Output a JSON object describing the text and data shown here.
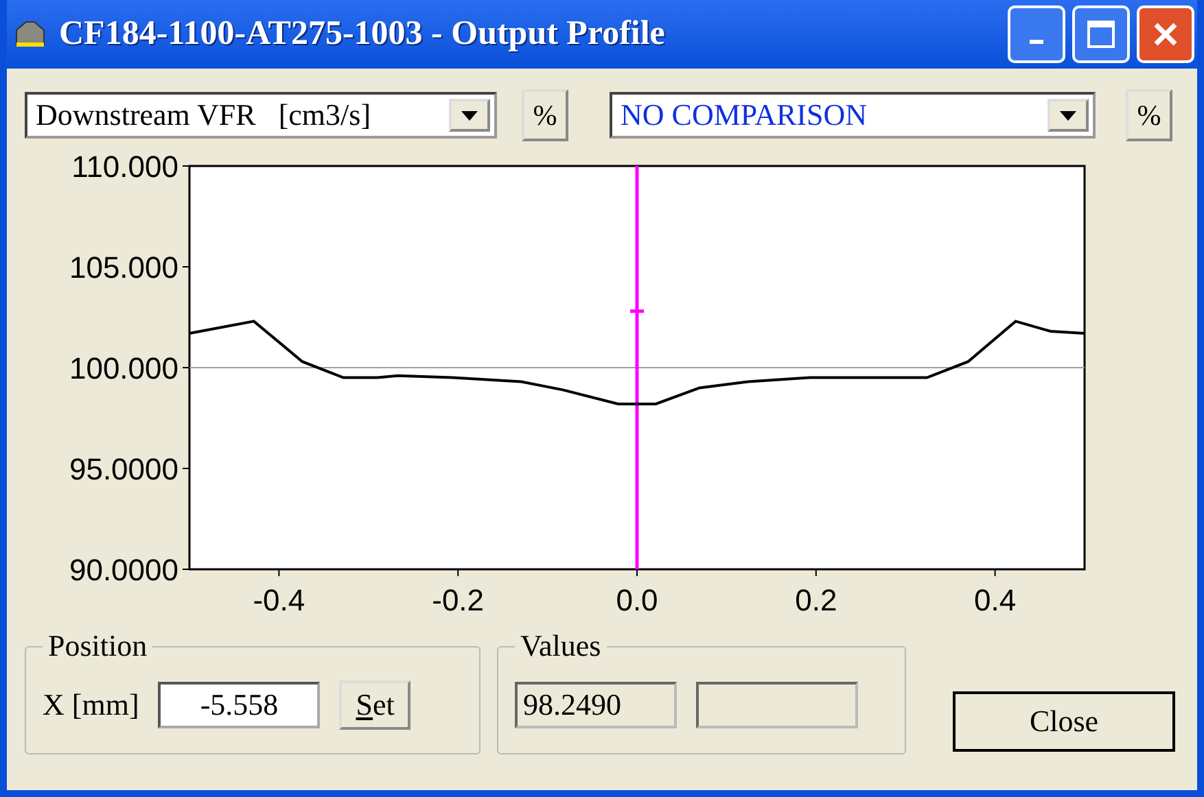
{
  "window": {
    "title": "CF184-1100-AT275-1003 - Output Profile"
  },
  "toolbar": {
    "quantity_select": {
      "value": "Downstream VFR   [cm3/s]"
    },
    "quantity_percent_button": "%",
    "comparison_select": {
      "value": "NO COMPARISON"
    },
    "comparison_percent_button": "%"
  },
  "chart": {
    "chart_data": {
      "type": "line",
      "xlim": [
        -0.5,
        0.5
      ],
      "ylim": [
        90,
        110
      ],
      "xticks": [
        {
          "value": -0.4,
          "label": "-0.4"
        },
        {
          "value": -0.2,
          "label": "-0.2"
        },
        {
          "value": 0,
          "label": "0.0"
        },
        {
          "value": 0.2,
          "label": "0.2"
        },
        {
          "value": 0.4,
          "label": "0.4"
        }
      ],
      "yticks": [
        {
          "value": 90,
          "label": "90.0000"
        },
        {
          "value": 95,
          "label": "95.0000"
        },
        {
          "value": 100,
          "label": "100.000"
        },
        {
          "value": 105,
          "label": "105.000"
        },
        {
          "value": 110,
          "label": "110.000"
        }
      ],
      "x": [
        -0.5,
        -0.428,
        -0.374,
        -0.328,
        -0.29,
        -0.267,
        -0.206,
        -0.129,
        -0.083,
        -0.021,
        0.021,
        0.07,
        0.124,
        0.193,
        0.27,
        0.324,
        0.37,
        0.423,
        0.462,
        0.5
      ],
      "series": [
        {
          "color": "#000000",
          "values": [
            101.7,
            102.3,
            100.3,
            99.5,
            99.5,
            99.6,
            99.5,
            99.3,
            98.9,
            98.2,
            98.2,
            99.0,
            99.3,
            99.5,
            99.5,
            99.5,
            100.3,
            102.3,
            101.8,
            101.7
          ]
        }
      ],
      "ref_lines": [
        {
          "axis": "y",
          "value": 100
        },
        {
          "axis": "x",
          "value": 0
        }
      ]
    }
  },
  "position": {
    "legend": "Position",
    "label": "X [mm]",
    "value": "-5.558",
    "set_button": "Set"
  },
  "values": {
    "legend": "Values",
    "reading": "98.2490"
  },
  "close_button": "Close"
}
